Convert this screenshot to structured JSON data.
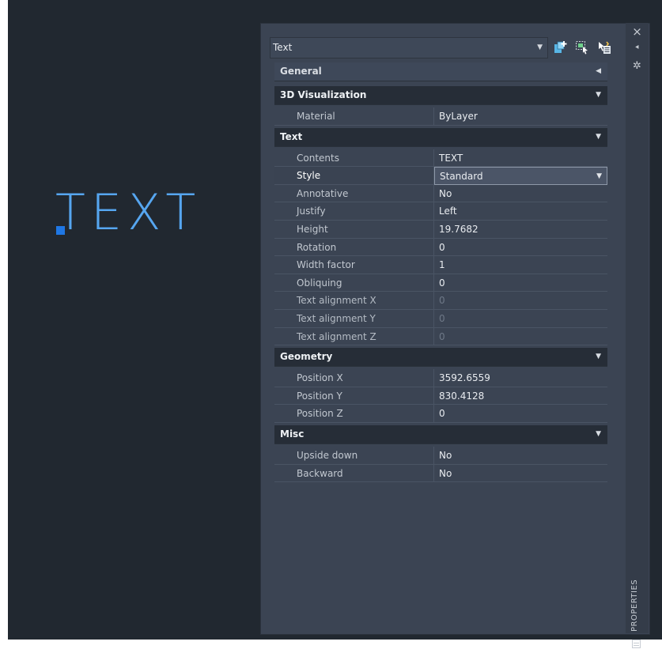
{
  "canvas": {
    "text": "TEXT",
    "grip_color": "#1f77e4",
    "text_color": "#56a6f0"
  },
  "palette": {
    "object_selector": "Text",
    "title": "PROPERTIES",
    "strip_buttons": {
      "close": "×",
      "autohide": "⯇",
      "settings": "✲"
    },
    "toolbar": [
      "toggle-pickadd-icon",
      "select-objects-icon",
      "quick-select-icon"
    ],
    "categories": {
      "general": {
        "label": "General"
      },
      "visualization": {
        "label": "3D Visualization",
        "rows": [
          {
            "name": "Material",
            "value": "ByLayer"
          }
        ]
      },
      "text": {
        "label": "Text",
        "rows": [
          {
            "name": "Contents",
            "value": "TEXT"
          },
          {
            "name": "Style",
            "value": "Standard"
          },
          {
            "name": "Annotative",
            "value": "No"
          },
          {
            "name": "Justify",
            "value": "Left"
          },
          {
            "name": "Height",
            "value": "19.7682"
          },
          {
            "name": "Rotation",
            "value": "0"
          },
          {
            "name": "Width factor",
            "value": "1"
          },
          {
            "name": "Obliquing",
            "value": "0"
          },
          {
            "name": "Text alignment X",
            "value": "0"
          },
          {
            "name": "Text alignment Y",
            "value": "0"
          },
          {
            "name": "Text alignment Z",
            "value": "0"
          }
        ]
      },
      "geometry": {
        "label": "Geometry",
        "rows": [
          {
            "name": "Position X",
            "value": "3592.6559"
          },
          {
            "name": "Position Y",
            "value": "830.4128"
          },
          {
            "name": "Position Z",
            "value": "0"
          }
        ]
      },
      "misc": {
        "label": "Misc",
        "rows": [
          {
            "name": "Upside down",
            "value": "No"
          },
          {
            "name": "Backward",
            "value": "No"
          }
        ]
      }
    }
  }
}
